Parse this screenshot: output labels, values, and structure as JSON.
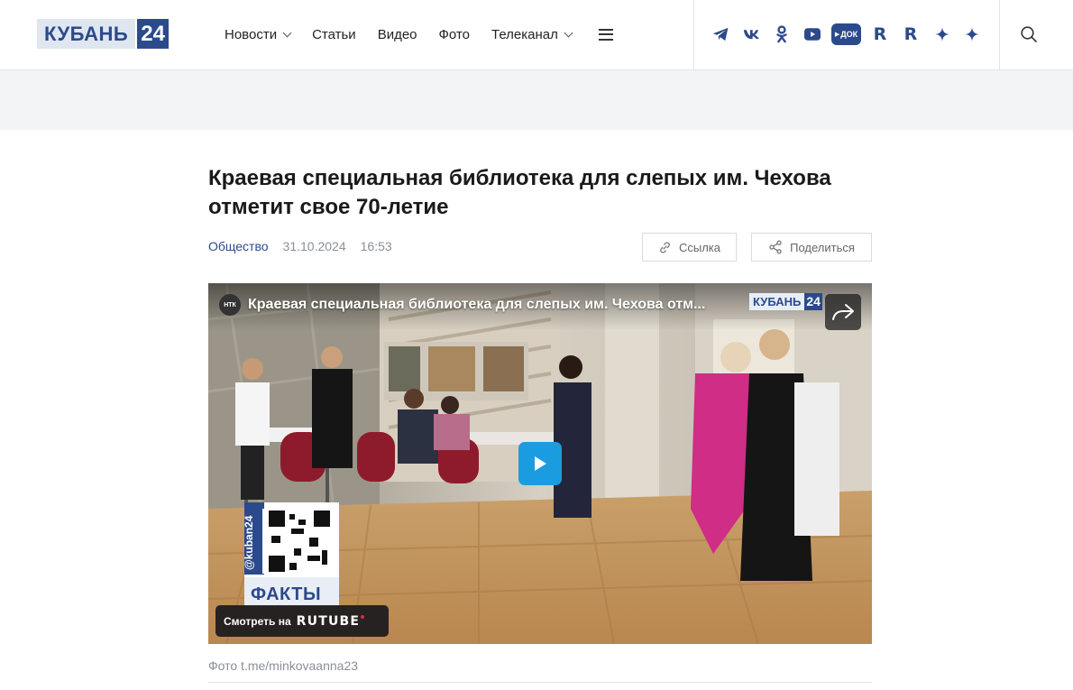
{
  "logo": {
    "text": "КУБАНЬ",
    "number": "24"
  },
  "nav": {
    "items": [
      {
        "label": "Новости",
        "dropdown": true
      },
      {
        "label": "Статьи",
        "dropdown": false
      },
      {
        "label": "Видео",
        "dropdown": false
      },
      {
        "label": "Фото",
        "dropdown": false
      },
      {
        "label": "Телеканал",
        "dropdown": true
      }
    ],
    "menu_icon": "hamburger-icon"
  },
  "socials": [
    {
      "icon": "telegram-icon"
    },
    {
      "icon": "vk-icon",
      "text": "VK"
    },
    {
      "icon": "odnoklassniki-icon"
    },
    {
      "icon": "youtube-icon"
    },
    {
      "icon": "dok-icon",
      "text": "ДОК"
    },
    {
      "icon": "rutube-icon",
      "text": "R"
    },
    {
      "icon": "rutube-icon",
      "text": "R"
    },
    {
      "icon": "dzen-icon"
    },
    {
      "icon": "dzen-icon"
    }
  ],
  "search_icon": "search-icon",
  "article": {
    "title": "Краевая специальная библиотека для слепых им. Чехова отметит свое 70-летие",
    "category": "Общество",
    "date": "31.10.2024",
    "time": "16:53",
    "link_button": "Ссылка",
    "share_button": "Поделиться"
  },
  "video": {
    "channel_badge": "НТК",
    "title": "Краевая специальная библиотека для слепых им. Чехова отм...",
    "watermark": "КУБАНЬ",
    "watermark_num": "24",
    "qr_handle": "@kuban24",
    "qr_label": "ФАКТЫ",
    "watch_on_prefix": "Смотреть на",
    "watch_on_brand": "RUTUBE"
  },
  "photo_caption": "Фото t.me/minkovaanna23",
  "colors": {
    "brand": "#2b4a8c",
    "play": "#1c9ce0",
    "muted": "#8a8f99"
  }
}
